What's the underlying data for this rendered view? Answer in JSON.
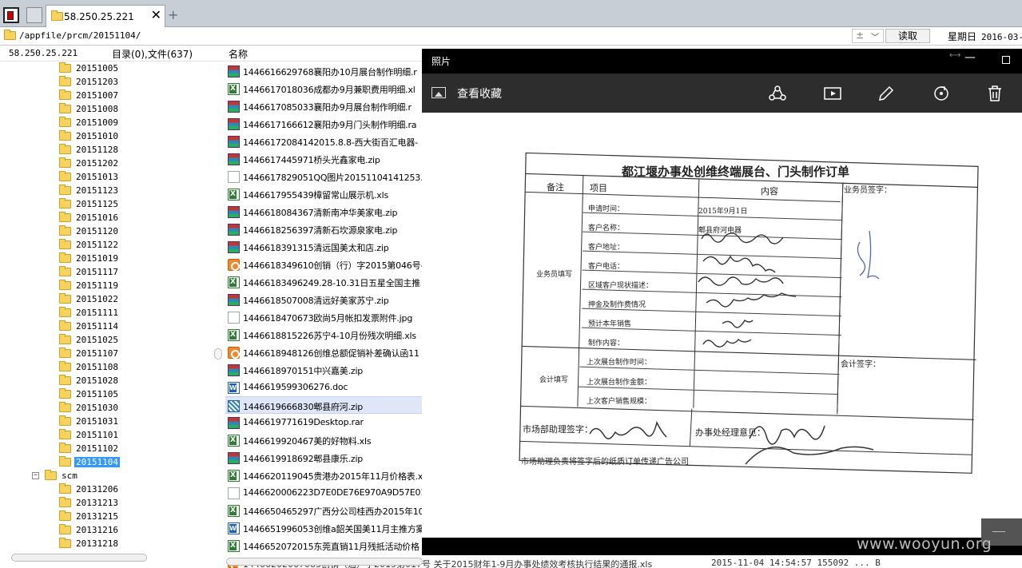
{
  "tab": {
    "title": "58.250.25.221"
  },
  "address": {
    "path": "/appfile/prcm/20151104/",
    "plus": "±",
    "read_label": "读取",
    "weekday": "星期日",
    "date": "2016-03-0"
  },
  "header": {
    "ip": "58.250.25.221",
    "dir_count": "目录(0),文件(637)",
    "name_col": "名称"
  },
  "tree": {
    "prcm_folders": [
      "20151005",
      "20151203",
      "20151007",
      "20151008",
      "20151009",
      "20151010",
      "20151128",
      "20151202",
      "20151013",
      "20151123",
      "20151125",
      "20151016",
      "20151120",
      "20151122",
      "20151019",
      "20151117",
      "20151119",
      "20151022",
      "20151111",
      "20151114",
      "20151025",
      "20151107",
      "20151108",
      "20151028",
      "20151105",
      "20151030",
      "20151031",
      "20151101",
      "20151102",
      "20151104"
    ],
    "selected": "20151104",
    "scm_label": "scm",
    "scm_folders": [
      "20131206",
      "20131213",
      "20131215",
      "20131216",
      "20131218"
    ]
  },
  "files": [
    {
      "icon": "rar-icon",
      "name": "1446616629768襄阳办10月展台制作明细.r"
    },
    {
      "icon": "xls-icon",
      "name": "1446617018036成都办9月兼职费用明细.xl"
    },
    {
      "icon": "rar-icon",
      "name": "1446617085033襄阳办9月展台制作明细.r"
    },
    {
      "icon": "rar-icon",
      "name": "1446617166612襄阳办9月门头制作明细.ra"
    },
    {
      "icon": "rar-icon",
      "name": "1446617208414​2015.8.8-西大街百汇电器-"
    },
    {
      "icon": "rar-icon",
      "name": "1446617445971桥头光鑫家电.zip"
    },
    {
      "icon": "jpg-icon",
      "name": "1446617829051QQ图片20151104141253.jpg"
    },
    {
      "icon": "xls-icon",
      "name": "1446617955439樟留常山展示机.xls"
    },
    {
      "icon": "rar-icon",
      "name": "1446618084367清新南冲华美家电.zip"
    },
    {
      "icon": "rar-icon",
      "name": "1446618256397清新石坎源泉家电.zip"
    },
    {
      "icon": "rar-icon",
      "name": "1446618391315清远国美太和店.zip"
    },
    {
      "icon": "orange-icon",
      "name": "1446618349610创销（行）字2015第046号-"
    },
    {
      "icon": "xls-icon",
      "name": "1446618349624​9.28-10.31日五星全国主推"
    },
    {
      "icon": "rar-icon",
      "name": "1446618507008清远好美家苏宁.zip"
    },
    {
      "icon": "jpg-icon",
      "name": "1446618470673欧尚5月帐扣发票附件.jpg"
    },
    {
      "icon": "xls-icon",
      "name": "1446618815226苏宁4-10月份残次明细.xls"
    },
    {
      "icon": "orange-icon",
      "name": "1446618948126创维总额促销补差确认函11"
    },
    {
      "icon": "rar-icon",
      "name": "1446618970151中兴嘉美.zip"
    },
    {
      "icon": "doc-icon",
      "name": "1446619599306276.doc"
    },
    {
      "icon": "zip-selected-icon",
      "name": "1446619666830郫县府河.zip"
    },
    {
      "icon": "rar-icon",
      "name": "1446619771619Desktop.rar"
    },
    {
      "icon": "xls-icon",
      "name": "1446619920467美的好物料.xls"
    },
    {
      "icon": "rar-icon",
      "name": "1446619918692郫县康乐.zip"
    },
    {
      "icon": "xls-icon",
      "name": "1446620119045贵港办2015年11月价格表.x"
    },
    {
      "icon": "jpg-icon",
      "name": "1446620006223D7E0DE76E970A9D57E0190B5"
    },
    {
      "icon": "xls-icon",
      "name": "1446650465297广西分公司桂西办2015年10"
    },
    {
      "icon": "doc-icon",
      "name": "1446651996053创维a韶关国美11月主推方案"
    },
    {
      "icon": "xls-icon",
      "name": "1446652072015东莞直销11月残抵活动价格"
    }
  ],
  "selected_file": "1446619666830郫县府河.zip",
  "behind_row": {
    "text": "1446620206​7083创销（通）字2015第017号 关于2015财年1-9月办事处绩效考核执行结果的通报.xls",
    "date": "2015-11-04 14:54:57 155092 ... B"
  },
  "viewer": {
    "app_title": "照片",
    "gallery_label": "查看收藏",
    "tools": [
      "share-icon",
      "slideshow-icon",
      "edit-icon",
      "rotate-icon",
      "delete-icon"
    ]
  },
  "document": {
    "title": "都江堰办事处创维终端展台、门头制作订单",
    "col_remark": "备注",
    "col_item": "项目",
    "col_content": "内容",
    "salesman_sign": "业务员签字：",
    "section_salesman": "业务员填写",
    "section_accounting": "会计填写",
    "accounting_sign": "会计签字：",
    "rows": [
      {
        "label": "申请时间：",
        "value": "2015年9月1日"
      },
      {
        "label": "客户名称：",
        "value": "郫县府河电器"
      },
      {
        "label": "客户地址：",
        "value": ""
      },
      {
        "label": "客户电话：",
        "value": ""
      },
      {
        "label": "区域客户现状描述：",
        "value": ""
      },
      {
        "label": "押金及制作费情况",
        "value": ""
      },
      {
        "label": "预计本年销售",
        "value": ""
      },
      {
        "label": "制作内容：",
        "value": ""
      }
    ],
    "acct_rows": [
      "上次展台制作时间：",
      "上次展台制作金额：",
      "上次客户销售规模："
    ],
    "market_sign": "市场部助理签字：",
    "office_opinion": "办事处经理意见：",
    "footer": "市场助理负责将签字后的纸质订单传递广告公司"
  },
  "watermark": "www.wooyun.org"
}
